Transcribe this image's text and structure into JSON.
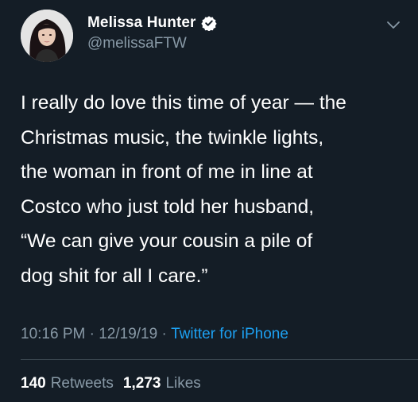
{
  "author": {
    "display_name": "Melissa Hunter",
    "handle": "@melissaFTW",
    "verified_icon": "verified-badge-icon"
  },
  "tweet": {
    "text": "I really do love this time of year — the\nChristmas music, the twinkle lights,\nthe woman in front of me in line at\nCostco who just told her husband,\n“We can give your cousin a pile of\ndog shit for all I care.”"
  },
  "meta": {
    "time": "10:16 PM",
    "separator1": " · ",
    "date": "12/19/19",
    "separator2": " · ",
    "source": "Twitter for iPhone"
  },
  "stats": {
    "retweets_count": "140",
    "retweets_label": "Retweets",
    "likes_count": "1,273",
    "likes_label": "Likes"
  },
  "colors": {
    "background": "#141d26",
    "secondary_text": "#8899a6",
    "accent": "#1da1f2"
  }
}
